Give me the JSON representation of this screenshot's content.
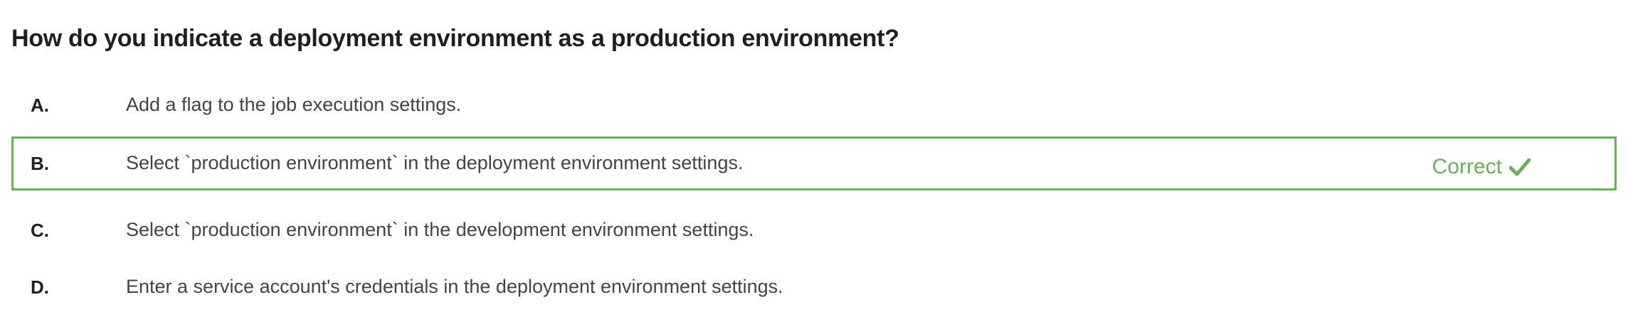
{
  "question": "How do you indicate a deployment environment as a production environment?",
  "options": [
    {
      "letter": "A.",
      "text": "Add a flag to the job execution settings."
    },
    {
      "letter": "B.",
      "text": "Select `production environment` in the deployment environment settings.",
      "status": "Correct"
    },
    {
      "letter": "C.",
      "text": "Select `production environment` in the development environment settings."
    },
    {
      "letter": "D.",
      "text": "Enter a service account's credentials in the deployment environment settings."
    }
  ],
  "colors": {
    "correct": "#6aaf5c"
  },
  "icons": {
    "correct": "checkmark-icon"
  }
}
